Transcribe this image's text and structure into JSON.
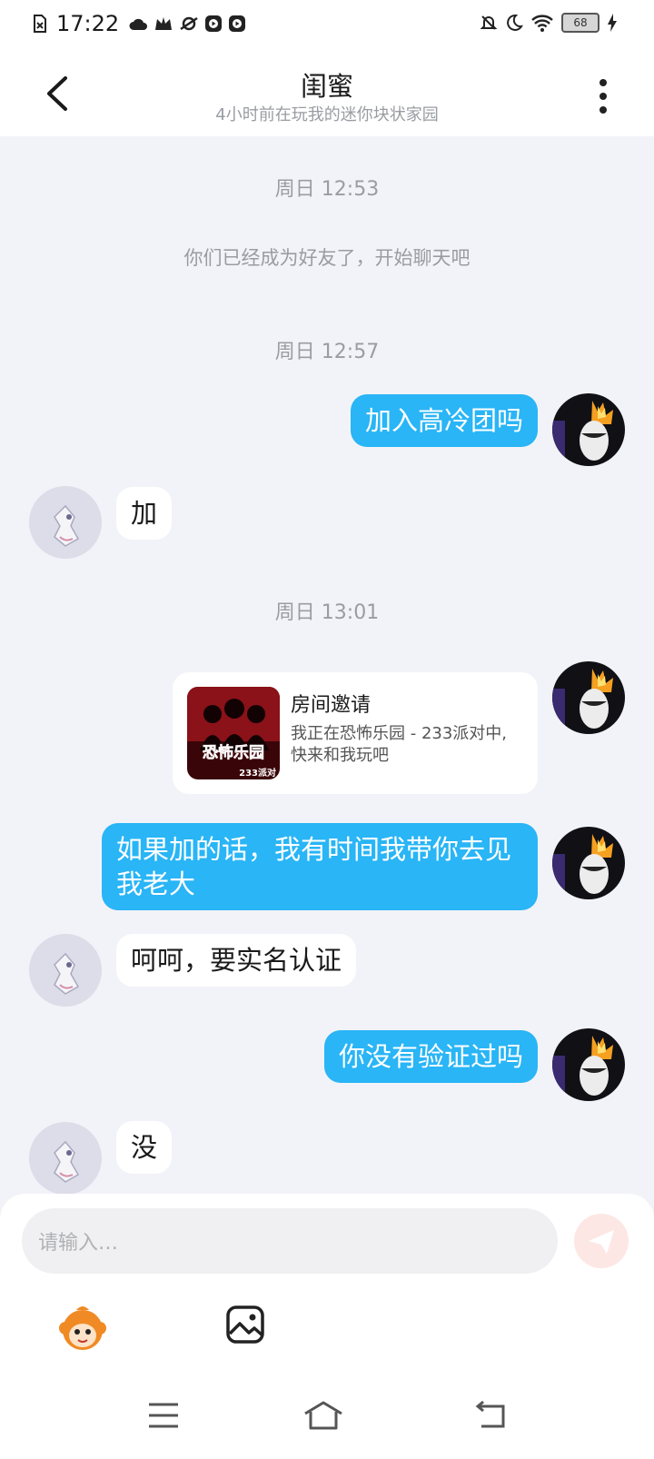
{
  "status_bar": {
    "time": "17:22",
    "battery": "68"
  },
  "header": {
    "title": "闺蜜",
    "subtitle": "4小时前在玩我的迷你块状家园"
  },
  "chat": {
    "timestamps": [
      "周日 12:53",
      "周日 12:57",
      "周日 13:01"
    ],
    "system_message": "你们已经成为好友了，开始聊天吧",
    "messages": [
      {
        "from": "me",
        "text": "加入高冷团吗"
      },
      {
        "from": "friend",
        "text": "加"
      },
      {
        "from": "me",
        "text": "如果加的话，我有时间我带你去见我老大"
      },
      {
        "from": "friend",
        "text": "呵呵，要实名认证"
      },
      {
        "from": "me",
        "text": "你没有验证过吗"
      },
      {
        "from": "friend",
        "text": "没"
      }
    ],
    "invite_card": {
      "title": "房间邀请",
      "description": "我正在恐怖乐园 - 233派对中, 快来和我玩吧",
      "image_text": "恐怖乐园",
      "image_badge": "233派对"
    }
  },
  "composer": {
    "placeholder": "请输入…"
  },
  "colors": {
    "accent": "#29b5f6",
    "background": "#f2f3f8",
    "send_button": "#fde7e4"
  },
  "icons": [
    "back-arrow-icon",
    "more-vertical-icon",
    "send-icon",
    "emoji-mascot-icon",
    "image-icon",
    "menu-icon",
    "home-icon",
    "back-nav-icon"
  ]
}
